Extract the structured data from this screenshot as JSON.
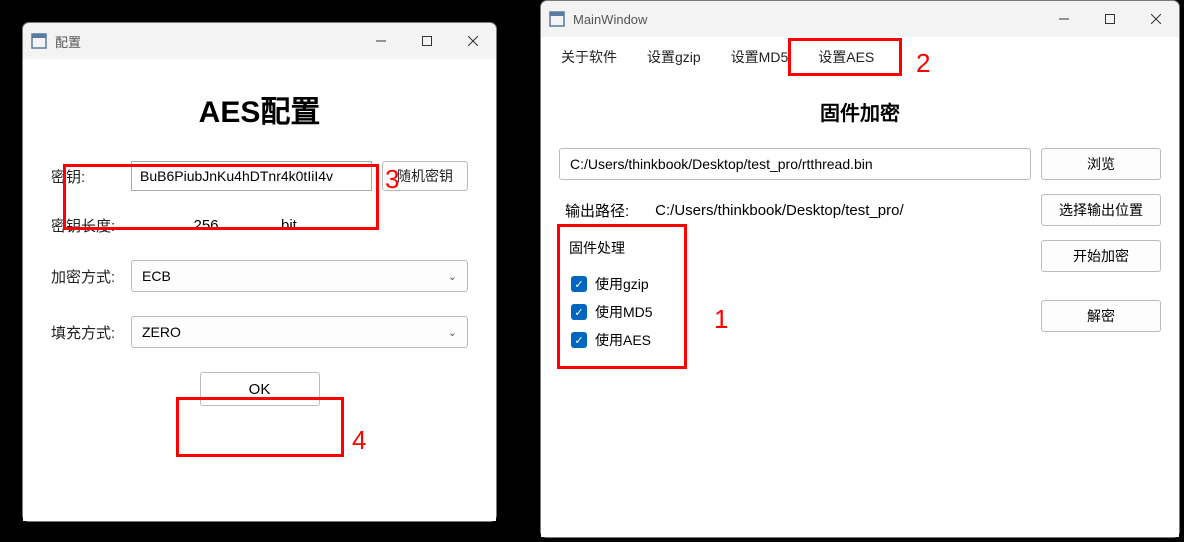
{
  "config_window": {
    "title": "配置",
    "heading": "AES配置",
    "key_label": "密钥:",
    "key_value": "BuB6PiubJnKu4hDTnr4k0tIiI4v",
    "random_key_btn": "随机密钥",
    "key_len_label": "密钥长度:",
    "key_len_value": "256",
    "key_len_unit": "bit",
    "enc_mode_label": "加密方式:",
    "enc_mode_value": "ECB",
    "padding_label": "填充方式:",
    "padding_value": "ZERO",
    "ok_btn": "OK"
  },
  "main_window": {
    "title": "MainWindow",
    "menu": {
      "about": "关于软件",
      "gzip": "设置gzip",
      "md5": "设置MD5",
      "aes": "设置AES"
    },
    "heading": "固件加密",
    "input_path": "C:/Users/thinkbook/Desktop/test_pro/rtthread.bin",
    "browse_btn": "浏览",
    "output_label": "输出路径:",
    "output_path": "C:/Users/thinkbook/Desktop/test_pro/",
    "select_output_btn": "选择输出位置",
    "groupbox_title": "固件处理",
    "chk_gzip": "使用gzip",
    "chk_md5": "使用MD5",
    "chk_aes": "使用AES",
    "start_btn": "开始加密",
    "decrypt_btn": "解密"
  },
  "annotations": {
    "n1": "1",
    "n2": "2",
    "n3": "3",
    "n4": "4"
  }
}
